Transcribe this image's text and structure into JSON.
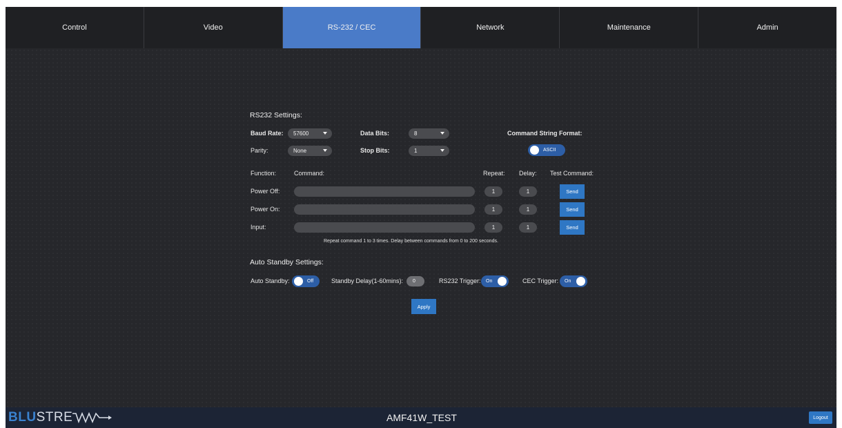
{
  "nav": {
    "tabs": [
      {
        "label": "Control"
      },
      {
        "label": "Video"
      },
      {
        "label": "RS-232 / CEC"
      },
      {
        "label": "Network"
      },
      {
        "label": "Maintenance"
      },
      {
        "label": "Admin"
      }
    ]
  },
  "rs232": {
    "title": "RS232 Settings:",
    "baud_rate_label": "Baud Rate:",
    "baud_rate_value": "57600",
    "data_bits_label": "Data Bits:",
    "data_bits_value": "8",
    "parity_label": "Parity:",
    "parity_value": "None",
    "stop_bits_label": "Stop Bits:",
    "stop_bits_value": "1",
    "command_format_label": "Command String Format:",
    "command_format_value": "ASCII"
  },
  "commands": {
    "headers": {
      "function": "Function:",
      "command": "Command:",
      "repeat": "Repeat:",
      "delay": "Delay:",
      "test": "Test Command:"
    },
    "rows": [
      {
        "function": "Power Off:",
        "command": "",
        "repeat": "1",
        "delay": "1",
        "send": "Send"
      },
      {
        "function": "Power On:",
        "command": "",
        "repeat": "1",
        "delay": "1",
        "send": "Send"
      },
      {
        "function": "Input:",
        "command": "",
        "repeat": "1",
        "delay": "1",
        "send": "Send"
      }
    ],
    "note": "Repeat command 1 to 3 times. Delay between commands from 0 to 200 seconds."
  },
  "standby": {
    "title": "Auto Standby Settings:",
    "auto_standby_label": "Auto Standby:",
    "auto_standby_value": "Off",
    "standby_delay_label": "Standby Delay(1-60mins):",
    "standby_delay_value": "0",
    "rs232_trigger_label": "RS232 Trigger:",
    "rs232_trigger_value": "On",
    "cec_trigger_label": "CEC Trigger:",
    "cec_trigger_value": "On"
  },
  "apply_label": "Apply",
  "footer": {
    "logo_blu": "BLU",
    "logo_rest": "STRE",
    "device_name": "AMF41W_TEST",
    "logout_label": "Logout"
  },
  "colors": {
    "accent": "#4a7bc8",
    "button": "#2f77c4",
    "background": "#26272b"
  }
}
